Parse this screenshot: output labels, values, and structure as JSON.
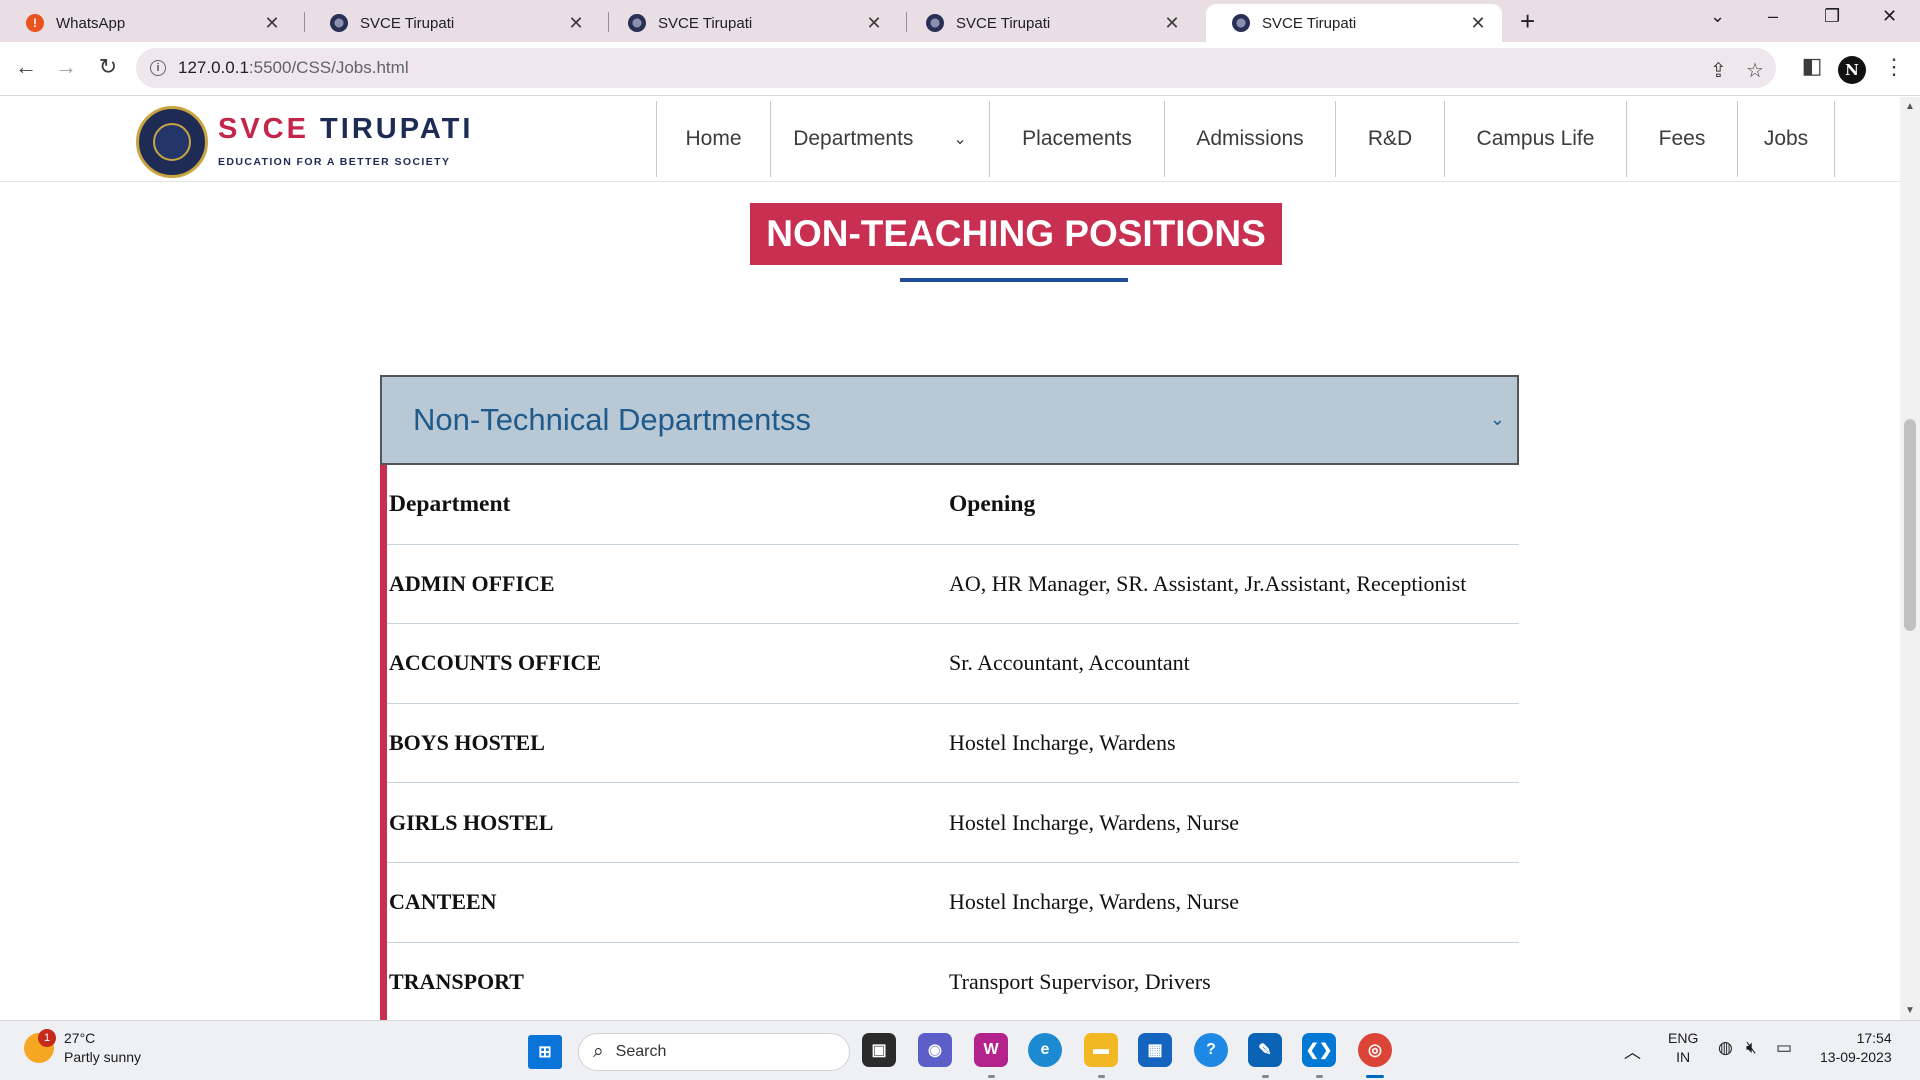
{
  "browser": {
    "tabs": [
      {
        "title": "WhatsApp",
        "icon": "whatsapp-alert-icon",
        "active": false
      },
      {
        "title": "SVCE Tirupati",
        "icon": "svce-favicon",
        "active": false
      },
      {
        "title": "SVCE Tirupati",
        "icon": "svce-favicon",
        "active": false
      },
      {
        "title": "SVCE Tirupati",
        "icon": "svce-favicon",
        "active": false
      },
      {
        "title": "SVCE Tirupati",
        "icon": "svce-favicon",
        "active": true
      }
    ],
    "url_host": "127.0.0.1",
    "url_path": ":5500/CSS/Jobs.html",
    "profile_initial": "N"
  },
  "site": {
    "brand_prefix": "SVCE",
    "brand_suffix": "TIRUPATI",
    "tagline": "EDUCATION FOR A BETTER SOCIETY",
    "nav": [
      {
        "label": "Home"
      },
      {
        "label": "Departments",
        "has_dropdown": true
      },
      {
        "label": "Placements"
      },
      {
        "label": "Admissions"
      },
      {
        "label": "R&D"
      },
      {
        "label": "Campus Life"
      },
      {
        "label": "Fees"
      },
      {
        "label": "Jobs"
      }
    ]
  },
  "page": {
    "heading": "NON-TEACHING POSITIONS",
    "accordion_title": "Non-Technical Departmentss",
    "table_headers": {
      "department": "Department",
      "opening": "Opening"
    },
    "rows": [
      {
        "department": "ADMIN OFFICE",
        "opening": "AO, HR Manager, SR. Assistant, Jr.Assistant, Receptionist"
      },
      {
        "department": "ACCOUNTS OFFICE",
        "opening": "Sr. Accountant, Accountant"
      },
      {
        "department": "BOYS HOSTEL",
        "opening": "Hostel Incharge, Wardens"
      },
      {
        "department": "GIRLS HOSTEL",
        "opening": "Hostel Incharge, Wardens, Nurse"
      },
      {
        "department": "CANTEEN",
        "opening": "Hostel Incharge, Wardens, Nurse"
      },
      {
        "department": "TRANSPORT",
        "opening": "Transport Supervisor, Drivers"
      }
    ]
  },
  "taskbar": {
    "weather_temp": "27°C",
    "weather_desc": "Partly sunny",
    "weather_badge": "1",
    "search_placeholder": "Search",
    "lang_top": "ENG",
    "lang_bottom": "IN",
    "time": "17:54",
    "date": "13-09-2023"
  },
  "colors": {
    "accent_red": "#c92f50",
    "brand_navy": "#1d2b55",
    "accordion_bg": "#b8c8d4",
    "accordion_text": "#1e5a8c",
    "underline_blue": "#1f4f9c"
  }
}
